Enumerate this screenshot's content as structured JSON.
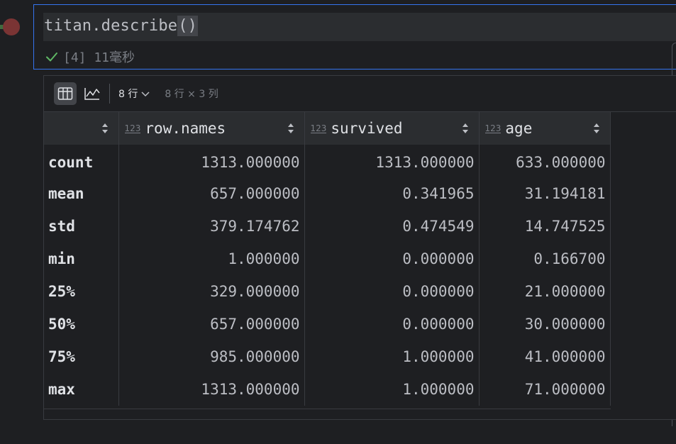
{
  "cell": {
    "code_prefix": "titan.describe",
    "code_parens": "()",
    "status_text": "[4] 11毫秒"
  },
  "toolbar": {
    "table_view_icon": "table-icon",
    "chart_view_icon": "chart-icon",
    "rows_label": "8 行",
    "dims_label": "8 行 × 3 列"
  },
  "table": {
    "type_badge": "123",
    "columns": [
      "",
      "row.names",
      "survived",
      "age"
    ],
    "rows": [
      [
        "count",
        "1313.000000",
        "1313.000000",
        "633.000000"
      ],
      [
        "mean",
        "657.000000",
        "0.341965",
        "31.194181"
      ],
      [
        "std",
        "379.174762",
        "0.474549",
        "14.747525"
      ],
      [
        "min",
        "1.000000",
        "0.000000",
        "0.166700"
      ],
      [
        "25%",
        "329.000000",
        "0.000000",
        "21.000000"
      ],
      [
        "50%",
        "657.000000",
        "0.000000",
        "30.000000"
      ],
      [
        "75%",
        "985.000000",
        "1.000000",
        "41.000000"
      ],
      [
        "max",
        "1313.000000",
        "1.000000",
        "71.000000"
      ]
    ]
  },
  "colors": {
    "accent": "#3574f0",
    "success": "#5fb865",
    "breakpoint": "#7a3434"
  }
}
